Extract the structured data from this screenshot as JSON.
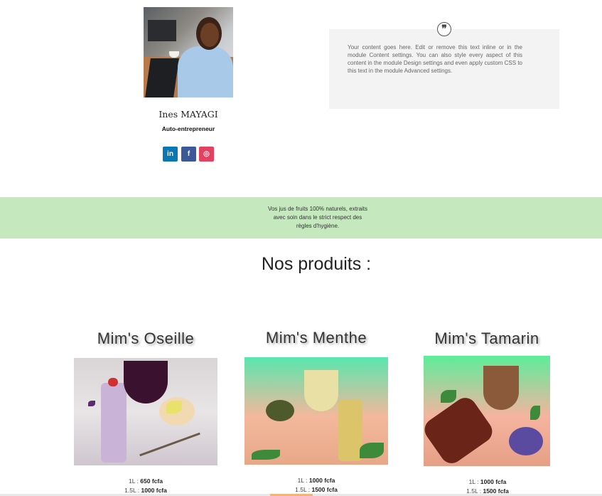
{
  "profile": {
    "name": "Ines MAYAGI",
    "role": "Auto-entrepreneur",
    "social": {
      "linkedin": "in",
      "facebook": "f",
      "instagram": "◎"
    }
  },
  "testimonial": {
    "quote_glyph": "❞",
    "text": "Your content goes here. Edit or remove this text inline or in the module Content settings. You can also style every aspect of this content in the module Design settings and even apply custom CSS to this text in the module Advanced settings."
  },
  "banner": {
    "line1": "Vos jus de fruits 100% naturels, extraits",
    "line2": "avec soin dans le strict respect des",
    "line3": "règles d'hygiène."
  },
  "products_title": "Nos produits :",
  "products": [
    {
      "name": "Mim's Oseille",
      "p1_label": "1L :",
      "p1_value": "650 fcfa",
      "p2_label": "1.5L :",
      "p2_value": "1000 fcfa"
    },
    {
      "name": "Mim's Menthe",
      "p1_label": "1L :",
      "p1_value": "1000 fcfa",
      "p2_label": "1.5L :",
      "p2_value": "1500 fcfa"
    },
    {
      "name": "Mim's Tamarin",
      "p1_label": "1L :",
      "p1_value": "1000 fcfa",
      "p2_label": "1.5L :",
      "p2_value": "1500 fcfa"
    }
  ],
  "colors": {
    "banner": "#c5e8bf",
    "linkedin": "#0a77b5",
    "facebook": "#3b5998",
    "instagram": "#e4405f"
  }
}
